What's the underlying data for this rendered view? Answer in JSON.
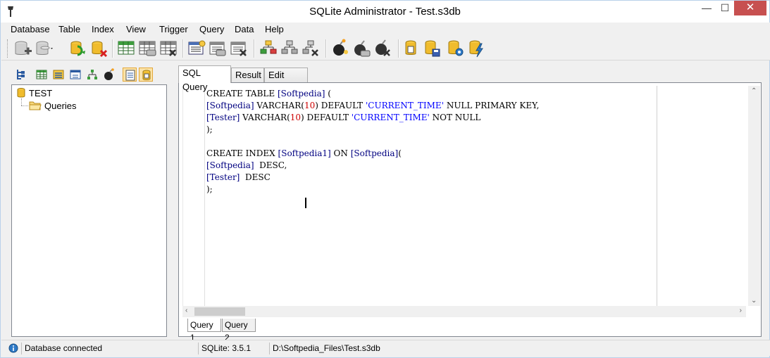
{
  "window": {
    "title": "SQLite Administrator - Test.s3db",
    "controls": {
      "minimize": "—",
      "maximize": "☐",
      "close": "✕"
    }
  },
  "menu": [
    "Database",
    "Table",
    "Index",
    "View",
    "Trigger",
    "Query",
    "Data",
    "Help"
  ],
  "toolbar": {
    "buttons": [
      "new-database-icon",
      "open-database-icon",
      "compact-database-icon",
      "close-database-icon",
      "create-table-icon",
      "edit-table-icon",
      "delete-table-icon",
      "create-index-icon",
      "edit-index-icon",
      "delete-index-icon",
      "create-view-icon",
      "edit-view-icon",
      "delete-view-icon",
      "create-trigger-icon",
      "edit-trigger-icon",
      "delete-trigger-icon",
      "open-query-icon",
      "save-query-icon",
      "query-settings-icon",
      "execute-query-icon"
    ]
  },
  "left_panel": {
    "tree": [
      {
        "label": "TEST",
        "icon": "database-icon"
      },
      {
        "label": "Queries",
        "icon": "folder-icon"
      }
    ]
  },
  "tabs": [
    {
      "label": "SQL Query",
      "active": true
    },
    {
      "label": "Result",
      "active": false
    },
    {
      "label": "Edit Data",
      "active": false
    }
  ],
  "editor": {
    "lines": [
      [
        [
          "kw",
          "CREATE TABLE "
        ],
        [
          "id",
          "[Softpedia]"
        ],
        [
          "kw",
          " ("
        ]
      ],
      [
        [
          "id",
          "[Softpedia]"
        ],
        [
          "kw",
          " VARCHAR("
        ],
        [
          "num",
          "10"
        ],
        [
          "kw",
          ") DEFAULT "
        ],
        [
          "str",
          "'CURRENT_TIME'"
        ],
        [
          "kw",
          " NULL PRIMARY KEY,"
        ]
      ],
      [
        [
          "id",
          "[Tester]"
        ],
        [
          "kw",
          " VARCHAR("
        ],
        [
          "num",
          "10"
        ],
        [
          "kw",
          ") DEFAULT "
        ],
        [
          "str",
          "'CURRENT_TIME'"
        ],
        [
          "kw",
          " NOT NULL"
        ]
      ],
      [
        [
          "kw",
          ");"
        ]
      ],
      [
        [
          "kw",
          ""
        ]
      ],
      [
        [
          "kw",
          "CREATE INDEX "
        ],
        [
          "id",
          "[Softpedia1]"
        ],
        [
          "kw",
          " ON "
        ],
        [
          "id",
          "[Softpedia]"
        ],
        [
          "kw",
          "("
        ]
      ],
      [
        [
          "id",
          "[Softpedia]"
        ],
        [
          "kw",
          "  DESC,"
        ]
      ],
      [
        [
          "id",
          "[Tester]"
        ],
        [
          "kw",
          "  DESC"
        ]
      ],
      [
        [
          "kw",
          ");"
        ]
      ]
    ]
  },
  "query_tabs": [
    {
      "label": "Query 1",
      "active": true
    },
    {
      "label": "Query 2",
      "active": false
    }
  ],
  "status": {
    "connection": "Database connected",
    "version": "SQLite: 3.5.1",
    "path": "D:\\Softpedia_Files\\Test.s3db"
  },
  "colors": {
    "identifier": "#000080",
    "number": "#cc0000",
    "string": "#0000ff",
    "close_button": "#c75050"
  }
}
